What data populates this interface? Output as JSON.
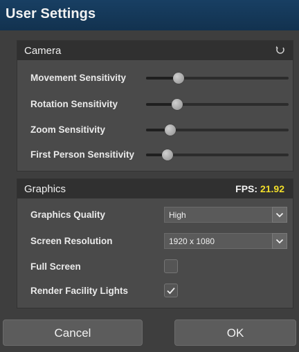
{
  "window": {
    "title": "User Settings"
  },
  "camera": {
    "header": "Camera",
    "reset_icon": "reset-icon",
    "sliders": [
      {
        "label": "Movement Sensitivity",
        "value": 0.23
      },
      {
        "label": "Rotation Sensitivity",
        "value": 0.22
      },
      {
        "label": "Zoom Sensitivity",
        "value": 0.17
      },
      {
        "label": "First Person Sensitivity",
        "value": 0.15
      }
    ]
  },
  "graphics": {
    "header": "Graphics",
    "fps_label": "FPS:",
    "fps_value": "21.92",
    "quality": {
      "label": "Graphics Quality",
      "value": "High"
    },
    "resolution": {
      "label": "Screen Resolution",
      "value": "1920 x 1080"
    },
    "full_screen": {
      "label": "Full Screen",
      "checked": false
    },
    "render_lights": {
      "label": "Render Facility Lights",
      "checked": true
    }
  },
  "buttons": {
    "cancel": "Cancel",
    "ok": "OK"
  },
  "colors": {
    "title_bar": "#183f63",
    "fps_value": "#f2de2a",
    "panel": "#4a4a4a",
    "header": "#303030"
  }
}
